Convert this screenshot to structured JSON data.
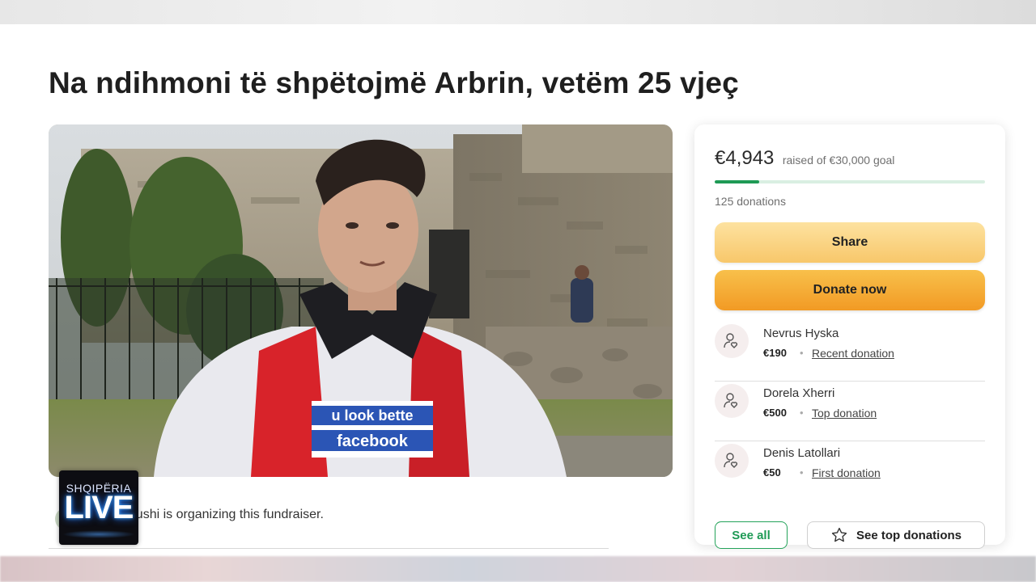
{
  "page": {
    "title": "Na ndihmoni të shpëtojmë Arbrin, vetëm 25 vjeç"
  },
  "hero": {
    "shirt_text_line1": "u look bette",
    "shirt_text_line2": "facebook"
  },
  "organizer": {
    "text": "anushi is organizing this fundraiser."
  },
  "logo": {
    "top": "SHQIPËRIA",
    "bottom": "LIVE"
  },
  "donation_card": {
    "raised": "€4,943",
    "goal_text": "raised of €30,000 goal",
    "progress_fraction": 0.165,
    "count": "125 donations",
    "share_label": "Share",
    "donate_label": "Donate now",
    "donations": [
      {
        "name": "Nevrus Hyska",
        "amount": "€190",
        "type": "Recent donation"
      },
      {
        "name": "Dorela Xherri",
        "amount": "€500",
        "type": "Top donation"
      },
      {
        "name": "Denis Latollari",
        "amount": "€50",
        "type": "First donation"
      }
    ],
    "see_all_label": "See all",
    "see_top_label": "See top donations"
  },
  "colors": {
    "accent_green": "#1e9a55",
    "share_yellow": "#f8c76a",
    "donate_orange": "#f29a24"
  }
}
